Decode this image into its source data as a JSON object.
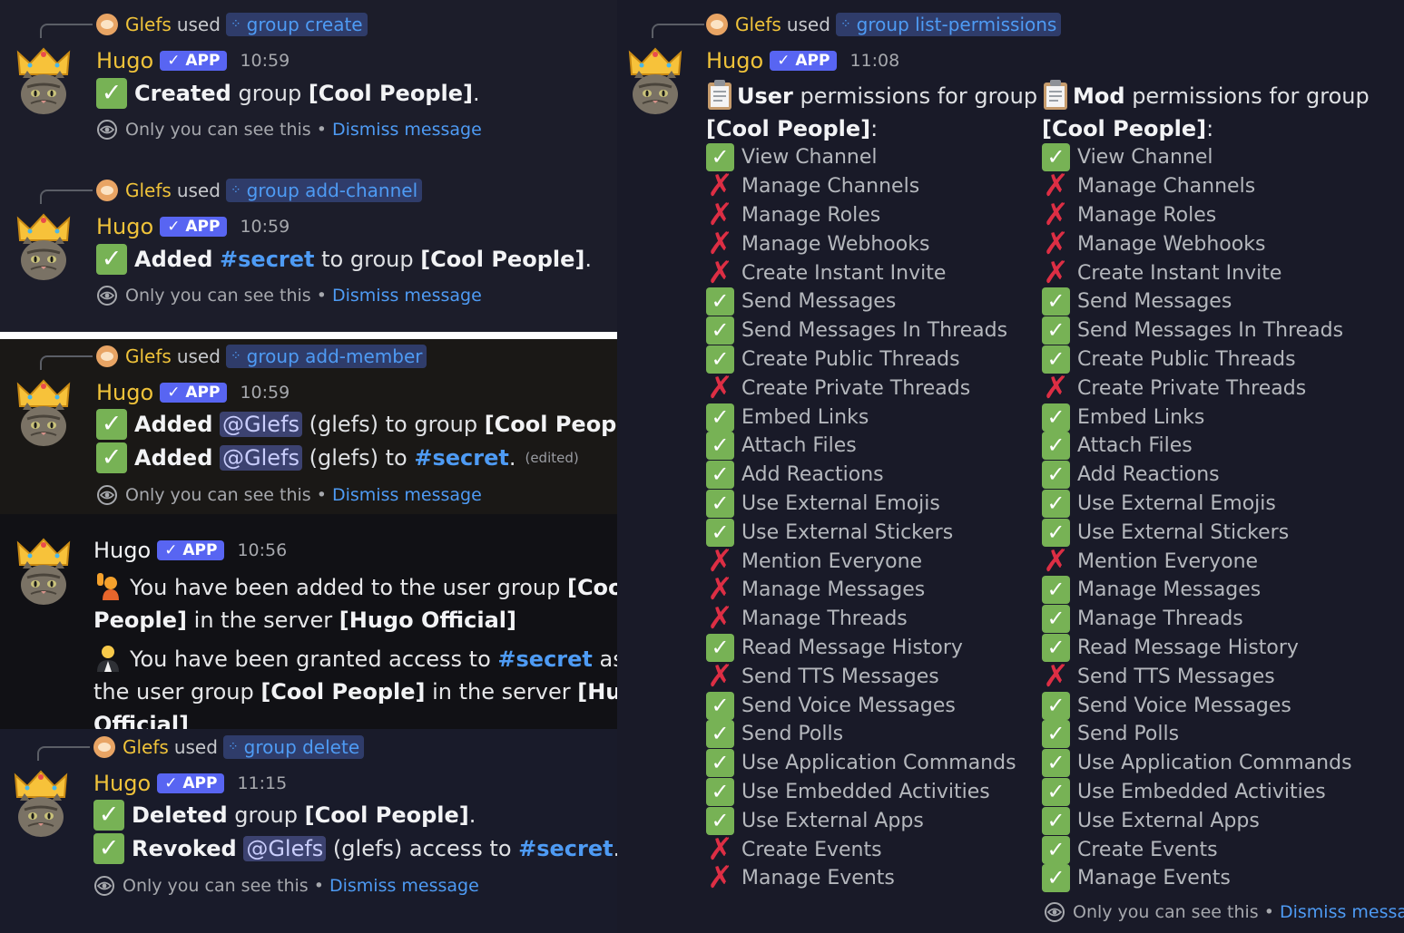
{
  "bot": {
    "name": "Hugo",
    "badge": "✓ APP"
  },
  "user": {
    "name": "Glefs",
    "handle": "glefs"
  },
  "common": {
    "used": "used",
    "ephemeral": "Only you can see this",
    "separator": "•",
    "dismiss": "Dismiss message",
    "edited": "(edited)"
  },
  "messages": [
    {
      "command": "group create",
      "time": "10:59",
      "lines": [
        {
          "bold": "Created",
          "text1": " group ",
          "group": "[Cool People]",
          "end": "."
        }
      ]
    },
    {
      "command": "group add-channel",
      "time": "10:59",
      "line": {
        "bold": "Added",
        "channel": "#secret",
        "text1": " to group ",
        "group": "[Cool People]",
        "end": "."
      }
    },
    {
      "command": "group add-member",
      "time": "10:59",
      "line1": {
        "bold": "Added",
        "mention": "@Glefs",
        "text1": " (glefs) to group ",
        "group": "[Cool People]",
        "end": "."
      },
      "line2": {
        "bold": "Added",
        "mention": "@Glefs",
        "text1": " (glefs) to ",
        "channel": "#secret",
        "end": "."
      }
    },
    {
      "time": "10:56",
      "notice1": {
        "text1": "You have been added to the user group ",
        "group": "[Cool People]",
        "text2": " in the server ",
        "server": "[Hugo Official]"
      },
      "notice2": {
        "text1": "You have been granted access to ",
        "channel": "#secret",
        "text2": " as part of the user group ",
        "group": "[Cool People]",
        "text3": " in the server ",
        "server": "[Hugo Official]"
      }
    },
    {
      "command": "group delete",
      "time": "11:15",
      "line1": {
        "bold": "Deleted",
        "text1": " group ",
        "group": "[Cool People]",
        "end": "."
      },
      "line2": {
        "bold": "Revoked",
        "mention": "@Glefs",
        "text1": " (glefs) access to ",
        "channel": "#secret",
        "end": "."
      }
    }
  ],
  "permissions_message": {
    "command": "group list-permissions",
    "time": "11:08",
    "user_head": {
      "role": "User",
      "text": " permissions for group ",
      "group": "[Cool People]",
      "end": ":"
    },
    "mod_head": {
      "role": "Mod",
      "text": " permissions for group ",
      "group": "[Cool People]",
      "end": ":"
    },
    "user_perms": [
      {
        "name": "View Channel",
        "allowed": true
      },
      {
        "name": "Manage Channels",
        "allowed": false
      },
      {
        "name": "Manage Roles",
        "allowed": false
      },
      {
        "name": "Manage Webhooks",
        "allowed": false
      },
      {
        "name": "Create Instant Invite",
        "allowed": false
      },
      {
        "name": "Send Messages",
        "allowed": true
      },
      {
        "name": "Send Messages In Threads",
        "allowed": true
      },
      {
        "name": "Create Public Threads",
        "allowed": true
      },
      {
        "name": "Create Private Threads",
        "allowed": false
      },
      {
        "name": "Embed Links",
        "allowed": true
      },
      {
        "name": "Attach Files",
        "allowed": true
      },
      {
        "name": "Add Reactions",
        "allowed": true
      },
      {
        "name": "Use External Emojis",
        "allowed": true
      },
      {
        "name": "Use External Stickers",
        "allowed": true
      },
      {
        "name": "Mention Everyone",
        "allowed": false
      },
      {
        "name": "Manage Messages",
        "allowed": false
      },
      {
        "name": "Manage Threads",
        "allowed": false
      },
      {
        "name": "Read Message History",
        "allowed": true
      },
      {
        "name": "Send TTS Messages",
        "allowed": false
      },
      {
        "name": "Send Voice Messages",
        "allowed": true
      },
      {
        "name": "Send Polls",
        "allowed": true
      },
      {
        "name": "Use Application Commands",
        "allowed": true
      },
      {
        "name": "Use Embedded Activities",
        "allowed": true
      },
      {
        "name": "Use External Apps",
        "allowed": true
      },
      {
        "name": "Create Events",
        "allowed": false
      },
      {
        "name": "Manage Events",
        "allowed": false
      }
    ],
    "mod_perms": [
      {
        "name": "View Channel",
        "allowed": true
      },
      {
        "name": "Manage Channels",
        "allowed": false
      },
      {
        "name": "Manage Roles",
        "allowed": false
      },
      {
        "name": "Manage Webhooks",
        "allowed": false
      },
      {
        "name": "Create Instant Invite",
        "allowed": false
      },
      {
        "name": "Send Messages",
        "allowed": true
      },
      {
        "name": "Send Messages In Threads",
        "allowed": true
      },
      {
        "name": "Create Public Threads",
        "allowed": true
      },
      {
        "name": "Create Private Threads",
        "allowed": false
      },
      {
        "name": "Embed Links",
        "allowed": true
      },
      {
        "name": "Attach Files",
        "allowed": true
      },
      {
        "name": "Add Reactions",
        "allowed": true
      },
      {
        "name": "Use External Emojis",
        "allowed": true
      },
      {
        "name": "Use External Stickers",
        "allowed": true
      },
      {
        "name": "Mention Everyone",
        "allowed": false
      },
      {
        "name": "Manage Messages",
        "allowed": true
      },
      {
        "name": "Manage Threads",
        "allowed": true
      },
      {
        "name": "Read Message History",
        "allowed": true
      },
      {
        "name": "Send TTS Messages",
        "allowed": false
      },
      {
        "name": "Send Voice Messages",
        "allowed": true
      },
      {
        "name": "Send Polls",
        "allowed": true
      },
      {
        "name": "Use Application Commands",
        "allowed": true
      },
      {
        "name": "Use Embedded Activities",
        "allowed": true
      },
      {
        "name": "Use External Apps",
        "allowed": true
      },
      {
        "name": "Create Events",
        "allowed": true
      },
      {
        "name": "Manage Events",
        "allowed": true
      }
    ]
  },
  "icons": {
    "check": "✓",
    "cross": "✗",
    "command": "⁘",
    "avatar": "crowned-cat-avatar",
    "eye": "eye-icon",
    "clipboard": "clipboard-icon"
  },
  "colors": {
    "username": "#f0c33a",
    "app_badge": "#5865f2",
    "link": "#4e9bf4",
    "check_bg": "#77b255",
    "cross": "#dd2e44"
  }
}
